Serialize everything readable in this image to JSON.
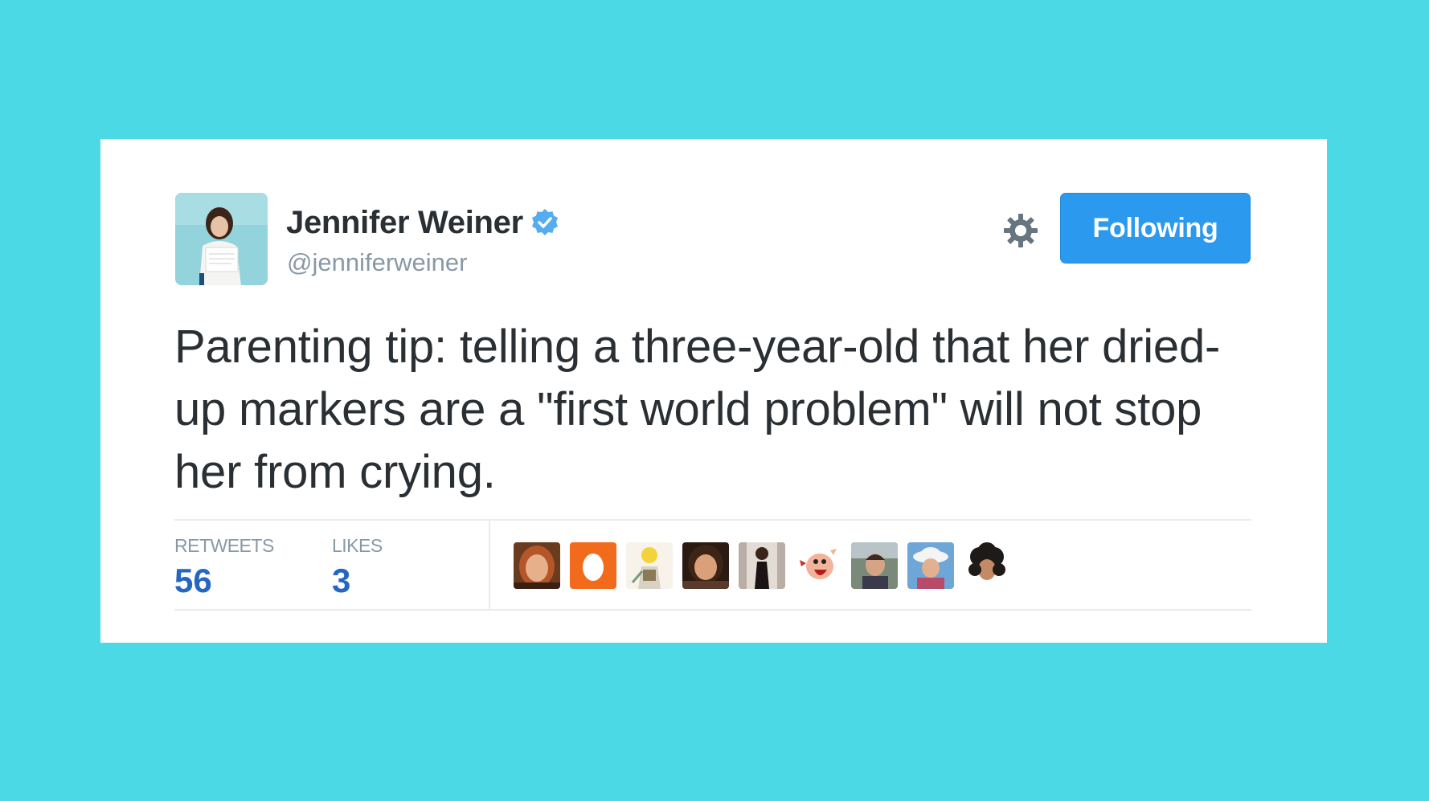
{
  "tweet": {
    "author": {
      "display_name": "Jennifer Weiner",
      "handle": "@jenniferweiner",
      "verified": true,
      "avatar_icon": "profile-photo"
    },
    "follow_button_label": "Following",
    "settings_icon": "gear-icon",
    "text": "Parenting tip: telling a three-year-old that her dried-up markers are a \"first world problem\" will not stop her from crying.",
    "stats": {
      "retweets_label": "RETWEETS",
      "retweets_count": "56",
      "likes_label": "LIKES",
      "likes_count": "3"
    },
    "liker_avatars": [
      "woman-red-hair-avatar",
      "orange-egg-avatar",
      "cartoon-figure-avatar",
      "woman-dark-hair-avatar",
      "woman-dark-dress-avatar",
      "cartoon-character-avatar",
      "person-outdoors-avatar",
      "person-with-hat-avatar",
      "dark-curly-hair-avatar"
    ]
  },
  "colors": {
    "background": "#4bd9e5",
    "card": "#ffffff",
    "button": "#2b9aee",
    "verified_badge": "#55acee",
    "stat_value": "#2566c4",
    "muted_text": "#8899a6",
    "body_text": "#292f33"
  }
}
